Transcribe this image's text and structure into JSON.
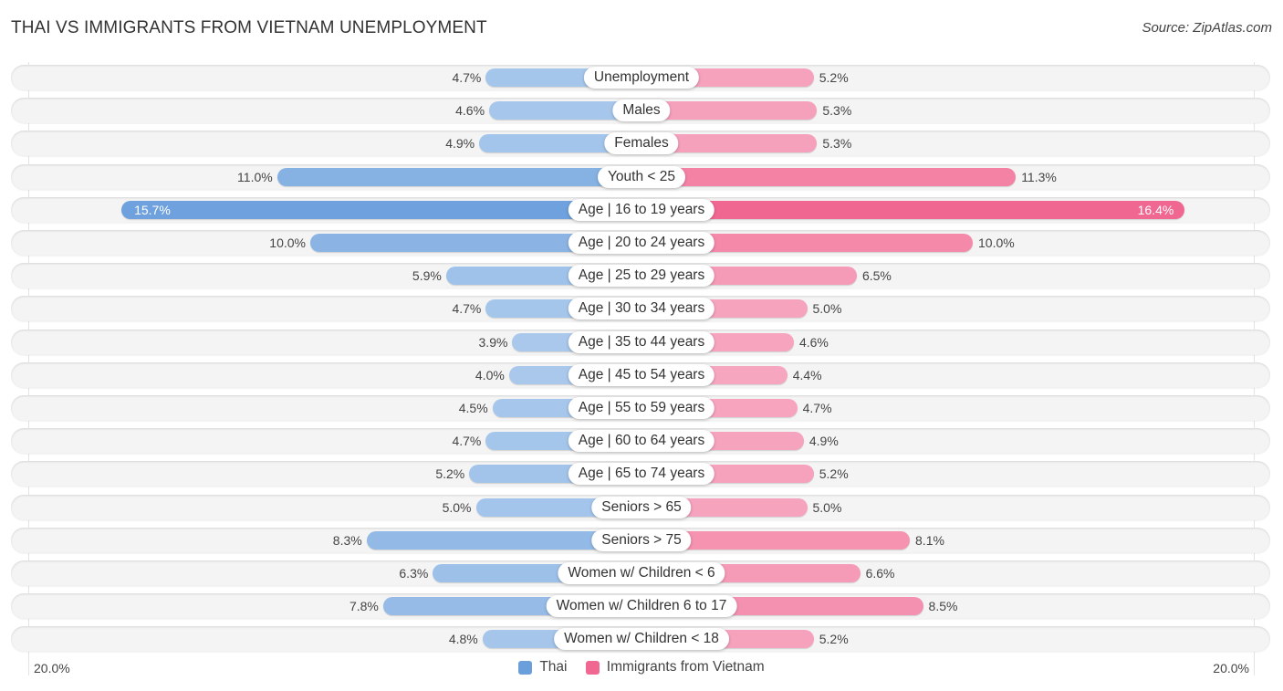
{
  "header": {
    "title": "THAI VS IMMIGRANTS FROM VIETNAM UNEMPLOYMENT",
    "source": "Source: ZipAtlas.com"
  },
  "colors": {
    "thai": "#6a9fdc",
    "thai_light": "#a9c8ec",
    "vietnam": "#f06891",
    "vietnam_light": "#f7a8c1"
  },
  "chart_data": {
    "type": "bar",
    "orientation": "horizontal-diverging",
    "title": "THAI VS IMMIGRANTS FROM VIETNAM UNEMPLOYMENT",
    "xlabel": "",
    "ylabel": "",
    "xlim": [
      -20,
      20
    ],
    "axis_labels": {
      "left": "20.0%",
      "right": "20.0%"
    },
    "legend": {
      "position": "bottom-center",
      "entries": [
        "Thai",
        "Immigrants from Vietnam"
      ]
    },
    "categories": [
      "Unemployment",
      "Males",
      "Females",
      "Youth < 25",
      "Age | 16 to 19 years",
      "Age | 20 to 24 years",
      "Age | 25 to 29 years",
      "Age | 30 to 34 years",
      "Age | 35 to 44 years",
      "Age | 45 to 54 years",
      "Age | 55 to 59 years",
      "Age | 60 to 64 years",
      "Age | 65 to 74 years",
      "Seniors > 65",
      "Seniors > 75",
      "Women w/ Children < 6",
      "Women w/ Children 6 to 17",
      "Women w/ Children < 18"
    ],
    "series": [
      {
        "name": "Thai",
        "side": "left",
        "values": [
          4.7,
          4.6,
          4.9,
          11.0,
          15.7,
          10.0,
          5.9,
          4.7,
          3.9,
          4.0,
          4.5,
          4.7,
          5.2,
          5.0,
          8.3,
          6.3,
          7.8,
          4.8
        ],
        "labels": [
          "4.7%",
          "4.6%",
          "4.9%",
          "11.0%",
          "15.7%",
          "10.0%",
          "5.9%",
          "4.7%",
          "3.9%",
          "4.0%",
          "4.5%",
          "4.7%",
          "5.2%",
          "5.0%",
          "8.3%",
          "6.3%",
          "7.8%",
          "4.8%"
        ]
      },
      {
        "name": "Immigrants from Vietnam",
        "side": "right",
        "values": [
          5.2,
          5.3,
          5.3,
          11.3,
          16.4,
          10.0,
          6.5,
          5.0,
          4.6,
          4.4,
          4.7,
          4.9,
          5.2,
          5.0,
          8.1,
          6.6,
          8.5,
          5.2
        ],
        "labels": [
          "5.2%",
          "5.3%",
          "5.3%",
          "11.3%",
          "16.4%",
          "10.0%",
          "6.5%",
          "5.0%",
          "4.6%",
          "4.4%",
          "4.7%",
          "4.9%",
          "5.2%",
          "5.0%",
          "8.1%",
          "6.6%",
          "8.5%",
          "5.2%"
        ]
      }
    ]
  }
}
